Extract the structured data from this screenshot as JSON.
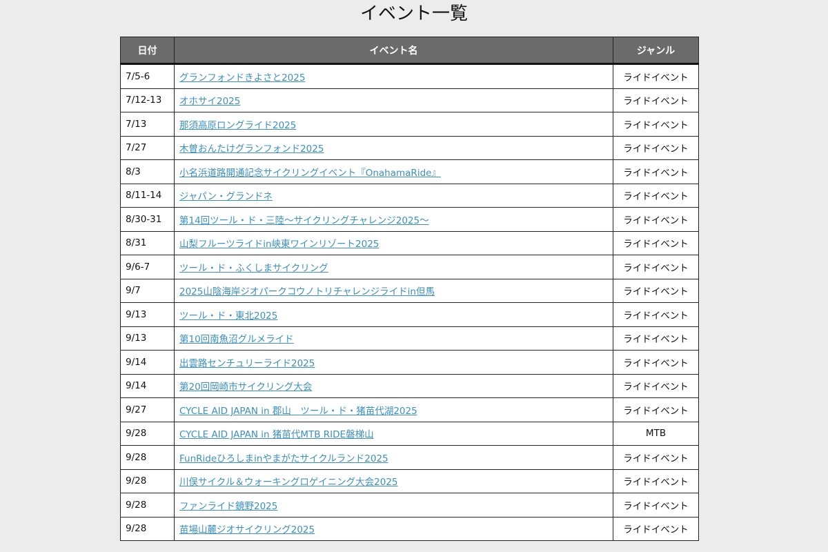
{
  "page": {
    "title": "イベント一覧"
  },
  "table": {
    "headers": {
      "date": "日付",
      "name": "イベント名",
      "genre": "ジャンル"
    },
    "rows": [
      {
        "date": "7/5-6",
        "name": "グランフォンドきよさと2025",
        "genre": "ライドイベント"
      },
      {
        "date": "7/12-13",
        "name": "オホサイ2025",
        "genre": "ライドイベント"
      },
      {
        "date": "7/13",
        "name": "那須高原ロングライド2025",
        "genre": "ライドイベント"
      },
      {
        "date": "7/27",
        "name": "木曽おんたけグランフォンド2025",
        "genre": "ライドイベント"
      },
      {
        "date": "8/3",
        "name": "小名浜道路開通記念サイクリングイベント『OnahamaRide』",
        "genre": "ライドイベント"
      },
      {
        "date": "8/11-14",
        "name": "ジャパン・グランドネ",
        "genre": "ライドイベント"
      },
      {
        "date": "8/30-31",
        "name": "第14回ツール・ド・三陸～サイクリングチャレンジ2025～",
        "genre": "ライドイベント"
      },
      {
        "date": "8/31",
        "name": "山梨フルーツライドin峡東ワインリゾート2025",
        "genre": "ライドイベント"
      },
      {
        "date": "9/6-7",
        "name": "ツール・ド・ふくしまサイクリング",
        "genre": "ライドイベント"
      },
      {
        "date": "9/7",
        "name": "2025山陰海岸ジオパークコウノトリチャレンジライドin但馬",
        "genre": "ライドイベント"
      },
      {
        "date": "9/13",
        "name": "ツール・ド・東北2025",
        "genre": "ライドイベント"
      },
      {
        "date": "9/13",
        "name": "第10回南魚沼グルメライド",
        "genre": "ライドイベント"
      },
      {
        "date": "9/14",
        "name": "出雲路センチュリーライド2025",
        "genre": "ライドイベント"
      },
      {
        "date": "9/14",
        "name": "第20回岡崎市サイクリング大会",
        "genre": "ライドイベント"
      },
      {
        "date": "9/27",
        "name": "CYCLE AID JAPAN in 郡山　ツール・ド・猪苗代湖2025",
        "genre": "ライドイベント"
      },
      {
        "date": "9/28",
        "name": "CYCLE AID JAPAN in 猪苗代MTB RIDE磐梯山",
        "genre": "MTB"
      },
      {
        "date": "9/28",
        "name": "FunRideひろしまinやまがたサイクルランド2025",
        "genre": "ライドイベント"
      },
      {
        "date": "9/28",
        "name": "川俣サイクル＆ウォーキングロゲイニング大会2025",
        "genre": "ライドイベント"
      },
      {
        "date": "9/28",
        "name": "ファンライド鏡野2025",
        "genre": "ライドイベント"
      },
      {
        "date": "9/28",
        "name": "苗場山麓ジオサイクリング2025",
        "genre": "ライドイベント"
      }
    ]
  }
}
